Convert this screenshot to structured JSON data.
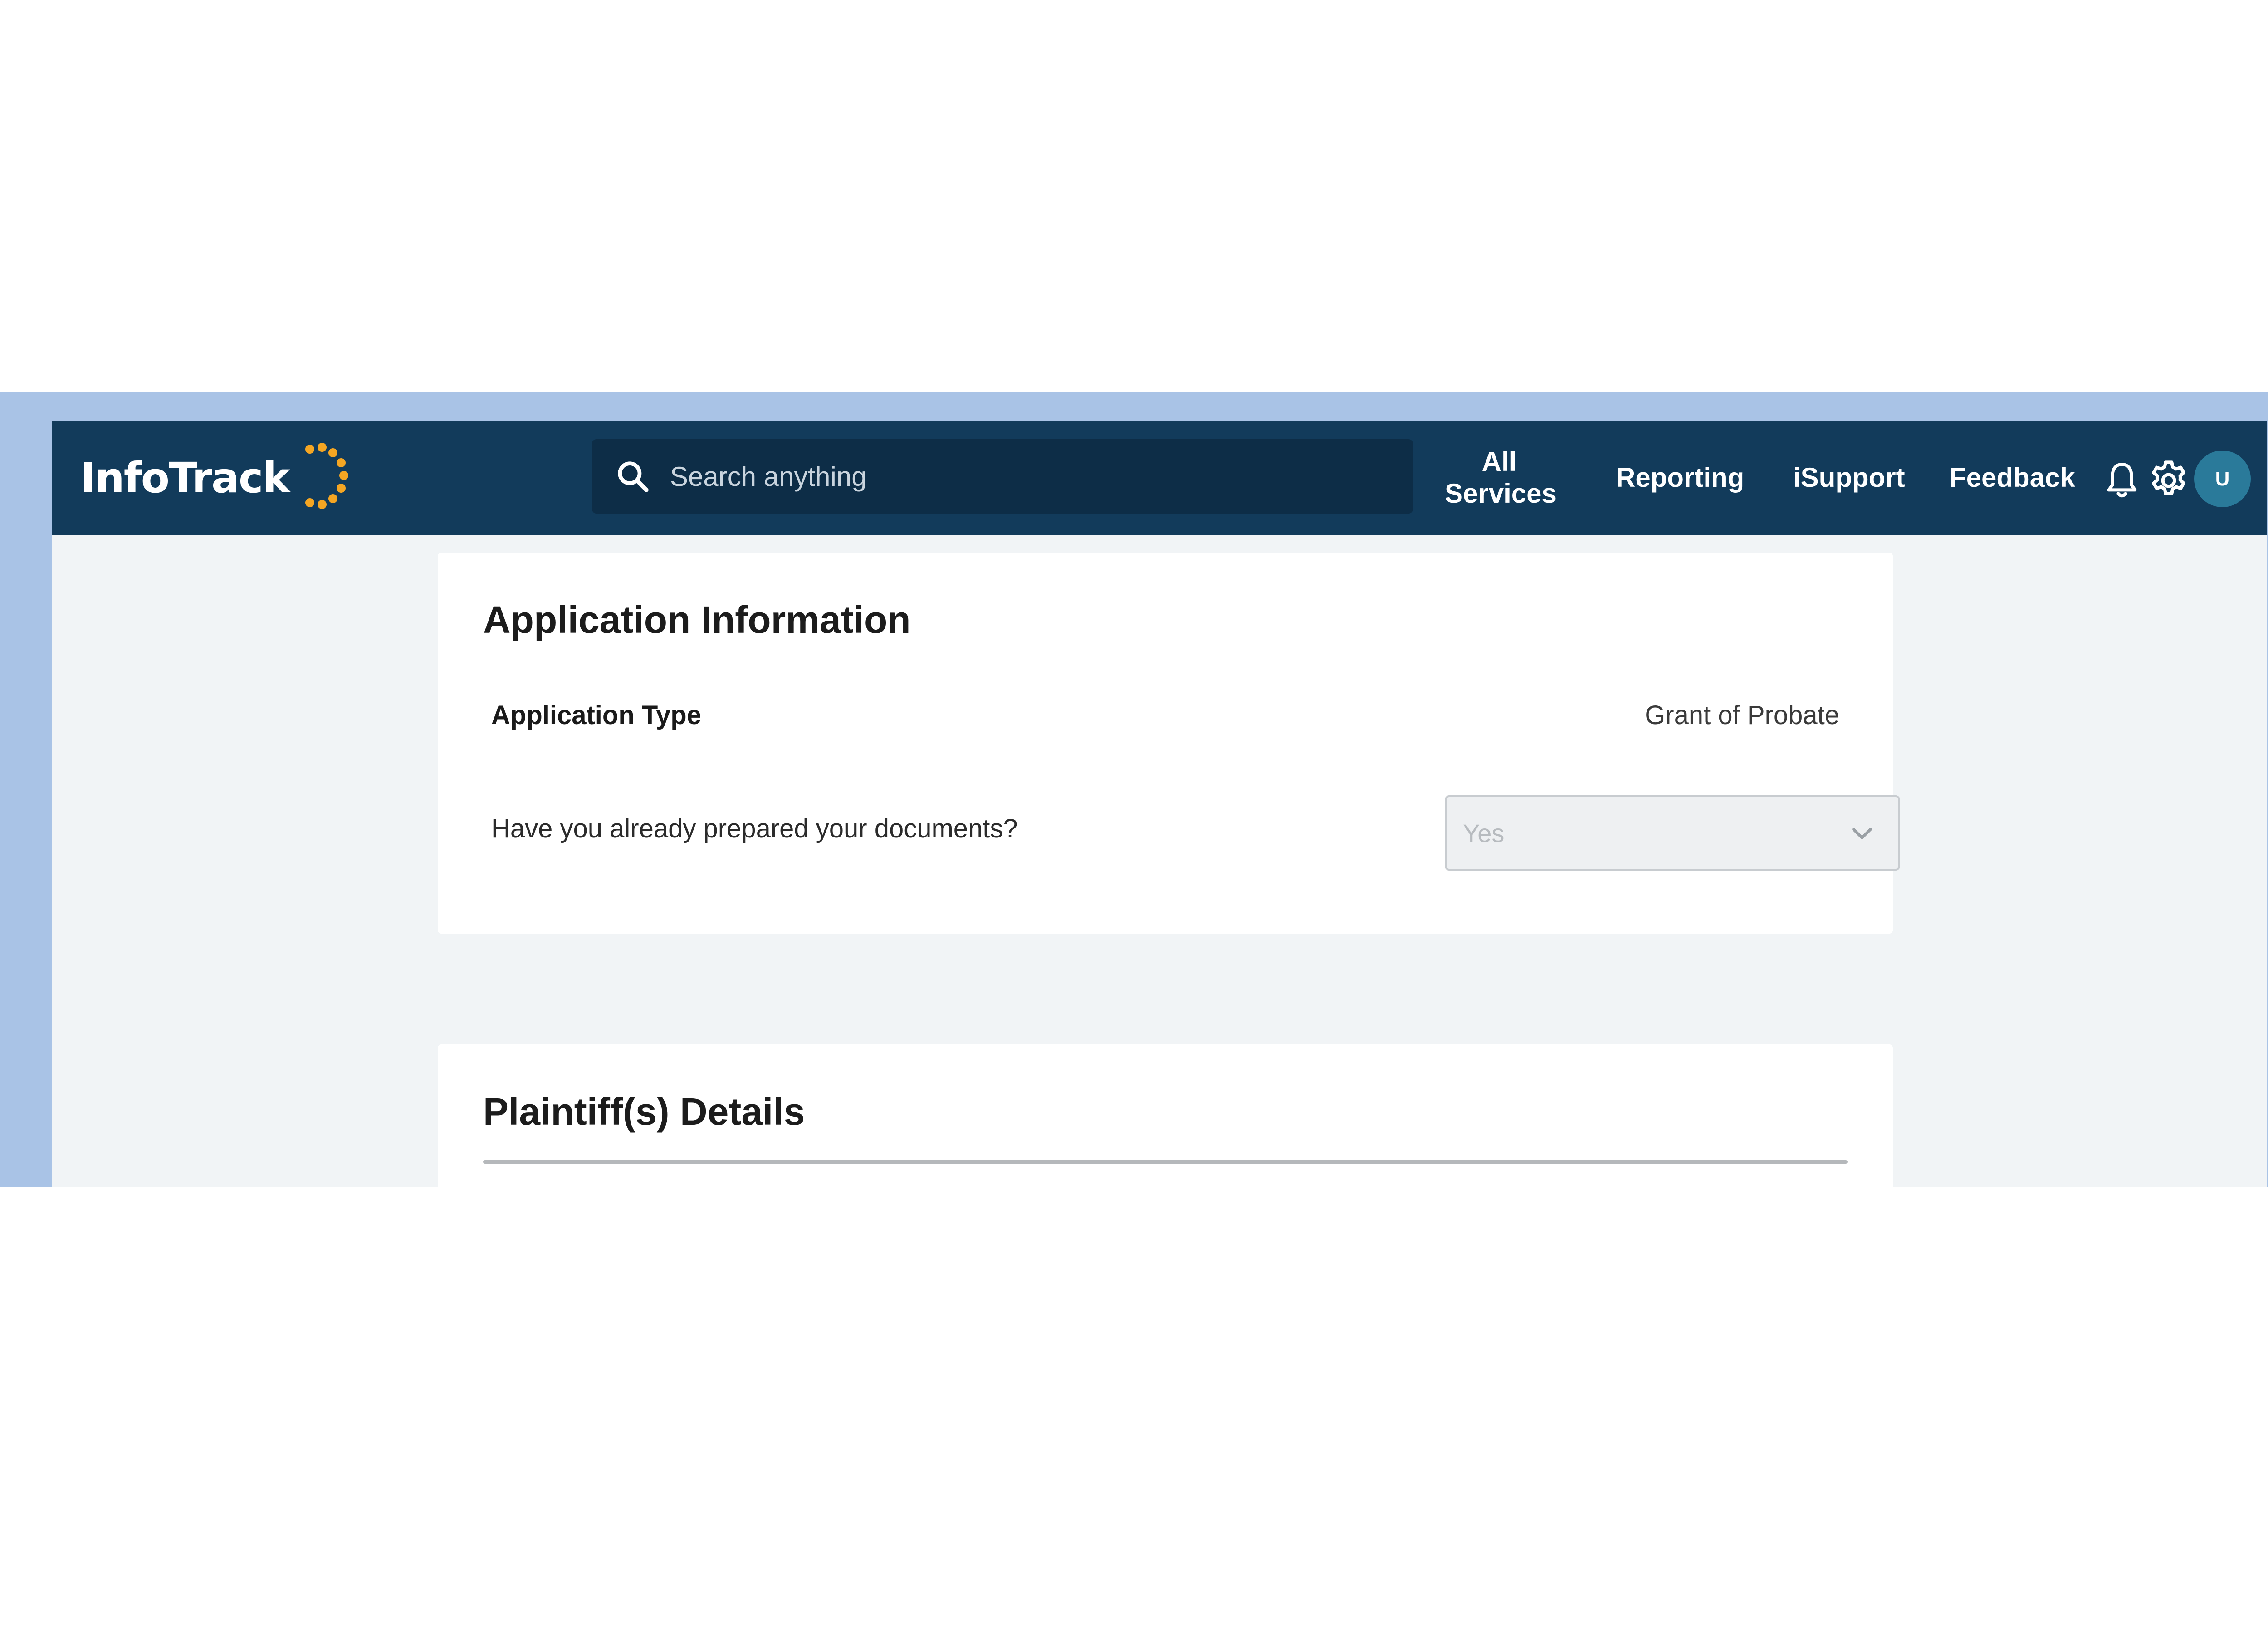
{
  "header": {
    "logo_text": "InfoTrack",
    "search": {
      "placeholder": "Search anything"
    },
    "nav": {
      "all_services_line1": "All",
      "all_services_line2": "Services",
      "reporting": "Reporting",
      "isupport": "iSupport",
      "feedback": "Feedback"
    },
    "icons": [
      "search-icon",
      "bell-icon",
      "gear-icon"
    ],
    "avatar_initial": "U"
  },
  "application_information": {
    "title": "Application Information",
    "application_type_label": "Application Type",
    "application_type_value": "Grant of Probate",
    "documents_question": "Have you already prepared your documents?",
    "documents_select_value": "Yes"
  },
  "plaintiff_details": {
    "title": "Plaintiff(s) Details"
  },
  "colors": {
    "header_bg": "#123b5b",
    "search_bg": "#0d2d47",
    "page_bg": "#f1f4f6",
    "outer_band": "#a9c3e6",
    "logo_accent": "#f5a623",
    "avatar_bg": "#2a7a9a"
  }
}
